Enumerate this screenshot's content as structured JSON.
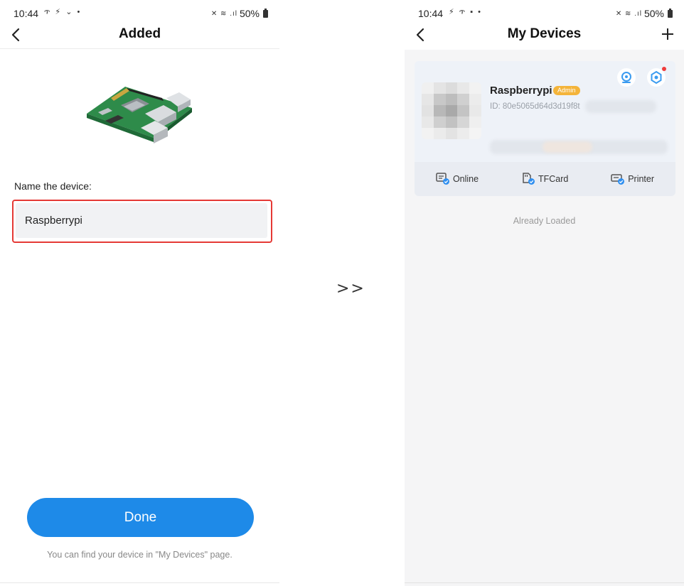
{
  "left_screen": {
    "status_time": "10:44",
    "status_icons_left": "ጥ ⚡ ⌄ •",
    "status_battery": "50%",
    "title": "Added",
    "name_label": "Name the device:",
    "name_value": "Raspberrypi",
    "done_label": "Done",
    "hint": "You can find your device in \"My Devices\" page."
  },
  "separator": ">>",
  "right_screen": {
    "status_time": "10:44",
    "status_icons_left": "⚡ ጥ ▪ •",
    "status_battery": "50%",
    "title": "My Devices",
    "device": {
      "name": "Raspberrypi",
      "badge": "Admin",
      "id": "ID: 80e5065d64d3d19f8t"
    },
    "features": [
      {
        "label": "Online",
        "icon": "online-icon"
      },
      {
        "label": "TFCard",
        "icon": "tfcard-icon"
      },
      {
        "label": "Printer",
        "icon": "printer-icon"
      }
    ],
    "footer": "Already Loaded"
  },
  "colors": {
    "accent": "#1e8ae8",
    "highlight_border": "#e53935",
    "admin_badge": "#f4b43a",
    "notification_dot": "#ef3b3b"
  }
}
